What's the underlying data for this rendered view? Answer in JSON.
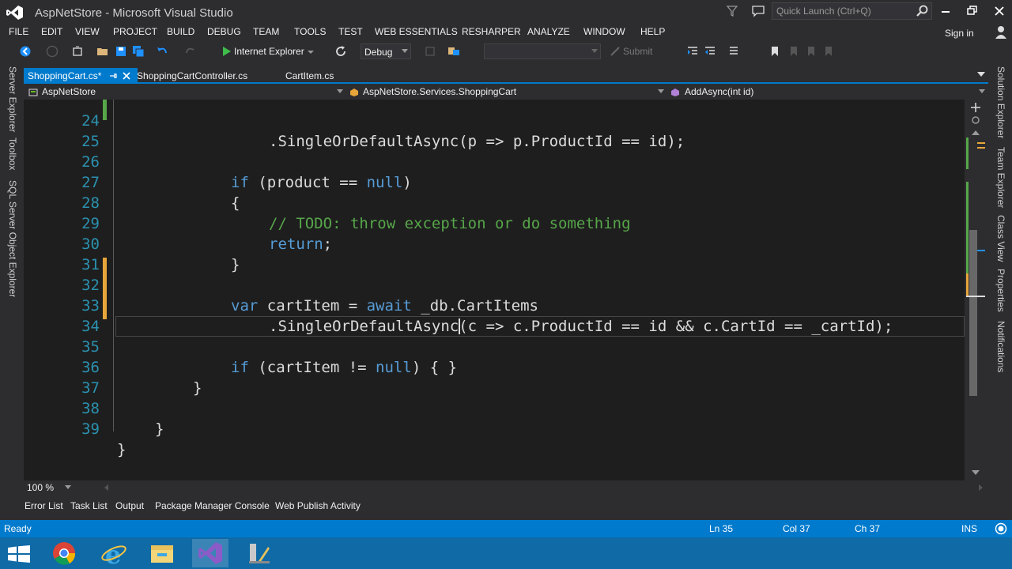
{
  "window": {
    "title": "AspNetStore - Microsoft Visual Studio",
    "quick_launch_placeholder": "Quick Launch (Ctrl+Q)"
  },
  "menu": {
    "items": [
      "FILE",
      "EDIT",
      "VIEW",
      "PROJECT",
      "BUILD",
      "DEBUG",
      "TEAM",
      "TOOLS",
      "TEST",
      "WEB ESSENTIALS",
      "RESHARPER",
      "ANALYZE",
      "WINDOW",
      "HELP"
    ],
    "sign_in": "Sign in"
  },
  "toolbar": {
    "run_target": "Internet Explorer",
    "configuration": "Debug",
    "platform": "",
    "submit": "Submit"
  },
  "left_tabs": [
    "Server Explorer",
    "Toolbox",
    "SQL Server Object Explorer"
  ],
  "right_tabs": [
    "Solution Explorer",
    "Team Explorer",
    "Class View",
    "Properties",
    "Notifications"
  ],
  "document_tabs": [
    {
      "label": "ShoppingCart.cs*",
      "active": true
    },
    {
      "label": "ShoppingCartController.cs",
      "active": false
    },
    {
      "label": "CartItem.cs",
      "active": false
    }
  ],
  "nav_bar": {
    "project": "AspNetStore",
    "type": "AspNetStore.Services.ShoppingCart",
    "member": "AddAsync(int id)"
  },
  "editor": {
    "partial_line": ".SingleOrDefaultAsync(p => p.ProductId == id);",
    "line_numbers": [
      "24",
      "25",
      "26",
      "27",
      "28",
      "29",
      "30",
      "31",
      "32",
      "33",
      "34",
      "35",
      "36",
      "37",
      "38",
      "39"
    ],
    "lines": [
      "            if (product == null)",
      "            {",
      "                // TODO: throw exception or do something",
      "                return;",
      "            }",
      "",
      "            var cartItem = await _db.CartItems",
      "                .SingleOrDefaultAsync(c => c.ProductId == id && c.CartId == _cartId);",
      "",
      "            if (cartItem != null) { }",
      "        }",
      "",
      "    }",
      "}"
    ],
    "keywords": {
      "if": "if",
      "null": "null",
      "return": "return",
      "var": "var",
      "await": "await"
    },
    "comment": "// TODO: throw exception or do something",
    "colors": {
      "keyword": "#569cd6",
      "comment": "#57a64a",
      "line_number": "#2b91af",
      "text": "#dcdcdc"
    }
  },
  "zoom": "100 %",
  "bottom_tabs": [
    "Error List",
    "Task List",
    "Output",
    "Package Manager Console",
    "Web Publish Activity"
  ],
  "status": {
    "text": "Ready",
    "ln": "Ln 35",
    "col": "Col 37",
    "ch": "Ch 37",
    "mode": "INS"
  },
  "taskbar": {
    "icons": [
      "windows-start-icon",
      "chrome-icon",
      "internet-explorer-icon",
      "file-explorer-icon",
      "visual-studio-icon",
      "tools-icon"
    ]
  }
}
